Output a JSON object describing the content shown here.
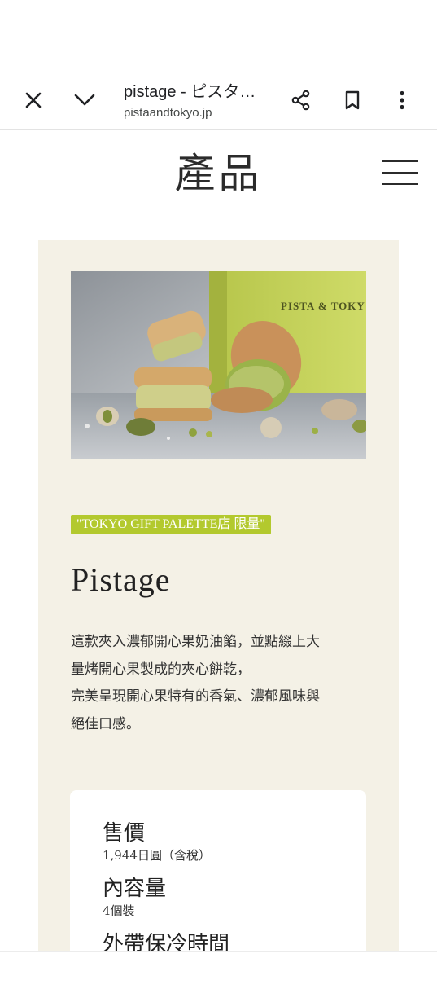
{
  "browser": {
    "title": "pistage - ピスタ…",
    "url": "pistaandtokyo.jp",
    "icons": [
      "close-icon",
      "chevron-down-icon",
      "share-icon",
      "bookmark-icon",
      "more-vert-icon"
    ]
  },
  "site": {
    "heading": "產品",
    "menu_icon": "hamburger-menu-icon"
  },
  "product": {
    "image_box_text": "PISTA & TOKY",
    "badge": "\"TOKYO GIFT PALETTE店 限量\"",
    "name": "Pistage",
    "description_lines": [
      "這款夾入濃郁開心果奶油餡，並點綴上大",
      "量烤開心果製成的夾心餅乾，",
      "完美呈現開心果特有的香氣、濃郁風味與",
      "絕佳口感。"
    ],
    "info": [
      {
        "label": "售價",
        "value": "1,944日圓（含稅）"
      },
      {
        "label": "內容量",
        "value": "4個裝"
      },
      {
        "label": "外帶保冷時間",
        "value": ""
      }
    ]
  },
  "colors": {
    "card_bg": "#f4f1e6",
    "badge_bg": "#b3c92e",
    "box_green": "#c8d65a"
  }
}
